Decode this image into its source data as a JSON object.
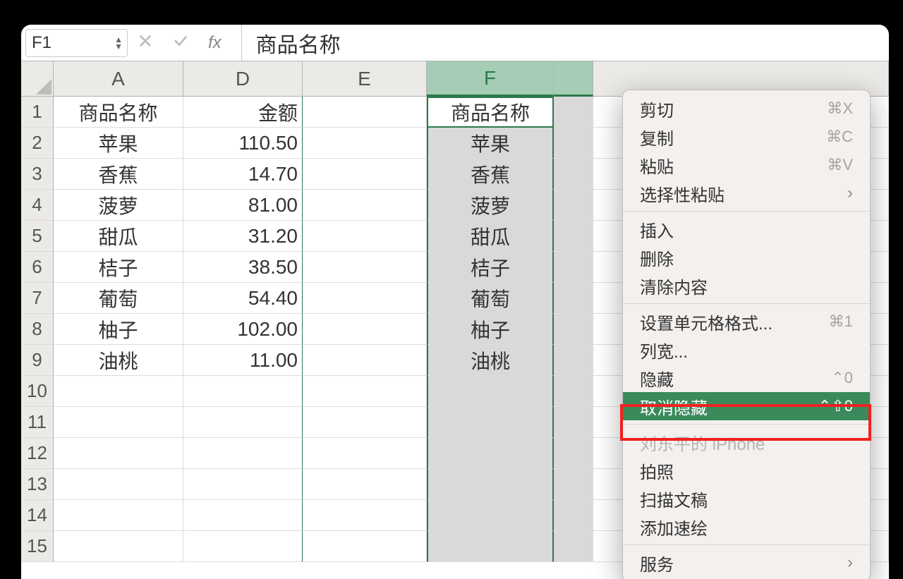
{
  "formula_bar": {
    "name_box": "F1",
    "fx_label": "fx",
    "value": "商品名称"
  },
  "columns": [
    {
      "key": "A",
      "label": "A",
      "width": 184
    },
    {
      "key": "D",
      "label": "D",
      "width": 169
    },
    {
      "key": "E",
      "label": "E",
      "width": 176
    },
    {
      "key": "F",
      "label": "F",
      "width": 180,
      "selected": true
    },
    {
      "key": "G",
      "label": "",
      "width": 56,
      "selected": true
    }
  ],
  "row_count": 15,
  "table": {
    "headers": {
      "A": "商品名称",
      "D": "金额",
      "F": "商品名称"
    },
    "rows": [
      {
        "A": "苹果",
        "D": "110.50",
        "F": "苹果"
      },
      {
        "A": "香蕉",
        "D": "14.70",
        "F": "香蕉"
      },
      {
        "A": "菠萝",
        "D": "81.00",
        "F": "菠萝"
      },
      {
        "A": "甜瓜",
        "D": "31.20",
        "F": "甜瓜"
      },
      {
        "A": "桔子",
        "D": "38.50",
        "F": "桔子"
      },
      {
        "A": "葡萄",
        "D": "54.40",
        "F": "葡萄"
      },
      {
        "A": "柚子",
        "D": "102.00",
        "F": "柚子"
      },
      {
        "A": "油桃",
        "D": "11.00",
        "F": "油桃"
      }
    ]
  },
  "context_menu": {
    "groups": [
      [
        {
          "label": "剪切",
          "shortcut": "⌘X"
        },
        {
          "label": "复制",
          "shortcut": "⌘C"
        },
        {
          "label": "粘贴",
          "shortcut": "⌘V"
        },
        {
          "label": "选择性粘贴",
          "submenu": true
        }
      ],
      [
        {
          "label": "插入"
        },
        {
          "label": "删除"
        },
        {
          "label": "清除内容"
        }
      ],
      [
        {
          "label": "设置单元格格式...",
          "shortcut": "⌘1"
        },
        {
          "label": "列宽..."
        },
        {
          "label": "隐藏",
          "shortcut": "⌃0"
        },
        {
          "label": "取消隐藏",
          "shortcut": "⌃⇧0",
          "hover": true
        }
      ],
      [
        {
          "label": "刘东平的 iPhone",
          "disabled": true
        },
        {
          "label": "拍照"
        },
        {
          "label": "扫描文稿"
        },
        {
          "label": "添加速绘"
        }
      ],
      [
        {
          "label": "服务",
          "submenu": true
        }
      ]
    ]
  }
}
